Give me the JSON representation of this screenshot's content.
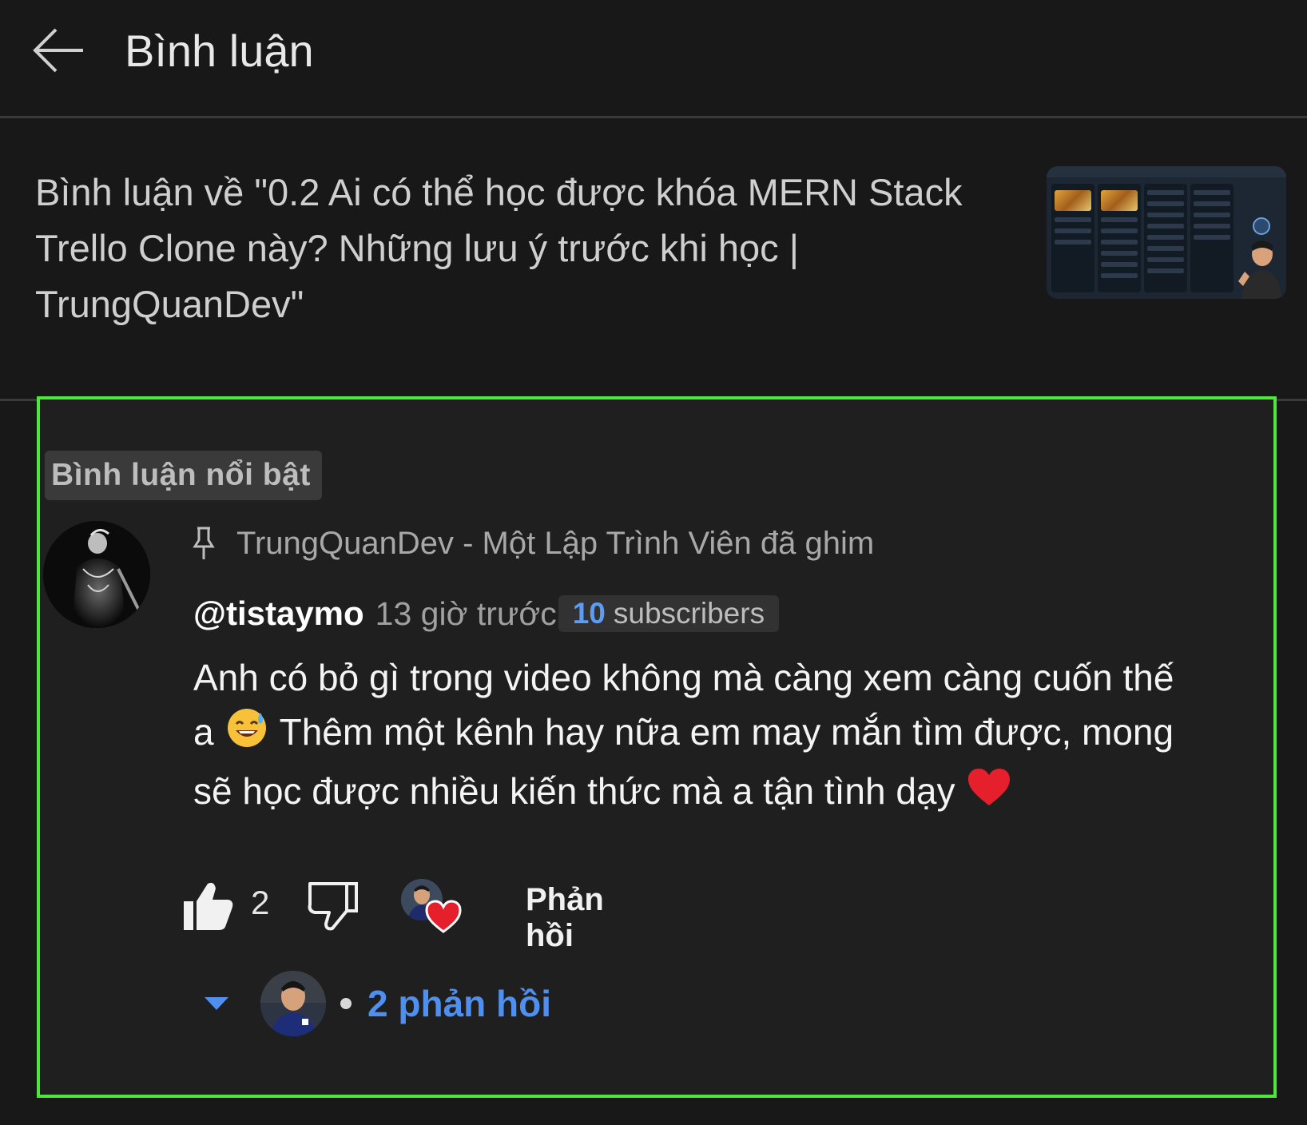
{
  "header": {
    "title": "Bình luận"
  },
  "video": {
    "title": "Bình luận về \"0.2 Ai có thể học được khóa MERN Stack Trello Clone này? Những lưu ý trước khi học | TrungQuanDev\""
  },
  "comment": {
    "featured_label": "Bình luận nổi bật",
    "pinned_text": "TrungQuanDev - Một Lập Trình Viên đã ghim",
    "author": "@tistaymo",
    "time": "13 giờ trước",
    "subscriber_count": "10",
    "subscriber_label": "subscribers",
    "text_part1": "Anh có bỏ gì trong video không mà càng xem càng cuốn thế a",
    "text_part2": "Thêm một kênh hay nữa em may mắn tìm được, mong sẽ học được nhiều kiến thức mà a tận tình dạy",
    "like_count": "2",
    "reply_label": "Phản hồi",
    "replies_label": "2 phản hồi"
  },
  "colors": {
    "background": "#181818",
    "highlight_border": "#4ee83a",
    "link_blue": "#4f8ff0",
    "heart_red": "#e5202c"
  },
  "icons": {
    "back": "arrow-left-icon",
    "pin": "pin-icon",
    "like": "thumbs-up-icon",
    "dislike": "thumbs-down-icon",
    "heart": "heart-icon",
    "expand": "caret-down-icon"
  }
}
